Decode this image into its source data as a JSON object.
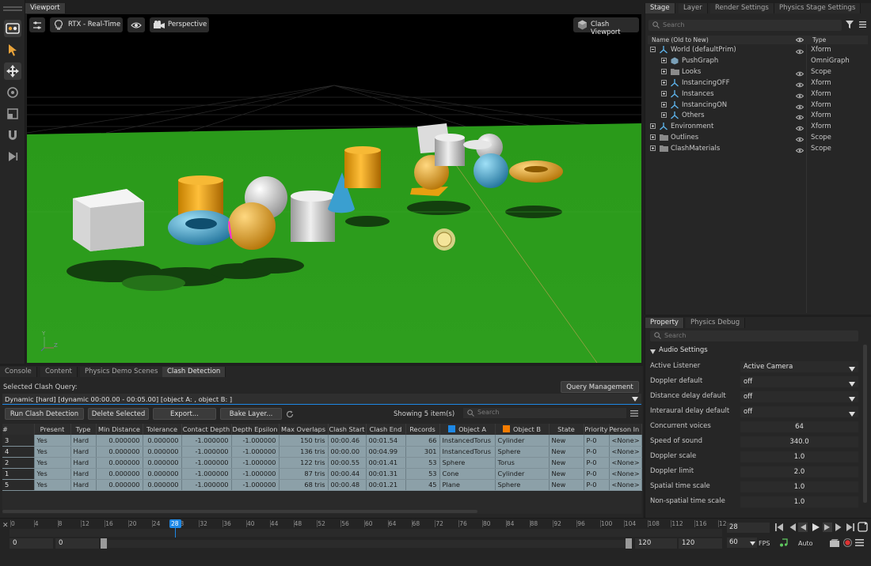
{
  "viewport": {
    "tab": "Viewport",
    "renderer": "RTX - Real-Time",
    "camera": "Perspective",
    "clash_viewport": "Clash Viewport"
  },
  "stage": {
    "tabs": [
      "Stage",
      "Layer",
      "Render Settings",
      "Physics Stage Settings"
    ],
    "search_placeholder": "Search",
    "col_name": "Name (Old to New)",
    "col_type": "Type",
    "tree": [
      {
        "label": "World (defaultPrim)",
        "type": "Xform",
        "indent": 0,
        "icon": "xform",
        "eye": true,
        "expand": "−"
      },
      {
        "label": "PushGraph",
        "type": "OmniGraph",
        "indent": 1,
        "icon": "graph",
        "eye": false,
        "expand": "+"
      },
      {
        "label": "Looks",
        "type": "Scope",
        "indent": 1,
        "icon": "folder",
        "eye": true,
        "expand": "+"
      },
      {
        "label": "InstancingOFF",
        "type": "Xform",
        "indent": 1,
        "icon": "xform",
        "eye": true,
        "expand": "+"
      },
      {
        "label": "Instances",
        "type": "Xform",
        "indent": 1,
        "icon": "xform",
        "eye": true,
        "expand": "+"
      },
      {
        "label": "InstancingON",
        "type": "Xform",
        "indent": 1,
        "icon": "xform",
        "eye": true,
        "expand": "+"
      },
      {
        "label": "Others",
        "type": "Xform",
        "indent": 1,
        "icon": "xform",
        "eye": true,
        "expand": "+"
      },
      {
        "label": "Environment",
        "type": "Xform",
        "indent": 0,
        "icon": "xform",
        "eye": true,
        "expand": "+"
      },
      {
        "label": "Outlines",
        "type": "Scope",
        "indent": 0,
        "icon": "folder",
        "eye": true,
        "expand": "+"
      },
      {
        "label": "ClashMaterials",
        "type": "Scope",
        "indent": 0,
        "icon": "folder",
        "eye": true,
        "expand": "+"
      }
    ]
  },
  "property": {
    "tabs": [
      "Property",
      "Physics Debug"
    ],
    "search_placeholder": "Search",
    "section": "Audio Settings",
    "rows": [
      {
        "label": "Active Listener",
        "value": "Active Camera",
        "kind": "select"
      },
      {
        "label": "Doppler default",
        "value": "off",
        "kind": "select"
      },
      {
        "label": "Distance delay default",
        "value": "off",
        "kind": "select"
      },
      {
        "label": "Interaural delay default",
        "value": "off",
        "kind": "select"
      },
      {
        "label": "Concurrent voices",
        "value": "64",
        "kind": "num"
      },
      {
        "label": "Speed of sound",
        "value": "340.0",
        "kind": "num"
      },
      {
        "label": "Doppler scale",
        "value": "1.0",
        "kind": "num"
      },
      {
        "label": "Doppler limit",
        "value": "2.0",
        "kind": "num"
      },
      {
        "label": "Spatial time scale",
        "value": "1.0",
        "kind": "num"
      },
      {
        "label": "Non-spatial time scale",
        "value": "1.0",
        "kind": "num"
      }
    ]
  },
  "bottom": {
    "tabs": [
      "Console",
      "Content",
      "Physics Demo Scenes",
      "Clash Detection"
    ],
    "selected_query_label": "Selected Clash Query:",
    "query_management": "Query Management",
    "query_value": "Dynamic [hard] [dynamic 00:00.00 - 00:05.00] [object A: , object B: ]",
    "buttons": {
      "run": "Run Clash Detection",
      "delete": "Delete Selected",
      "export": "Export...",
      "bake": "Bake Layer..."
    },
    "showing": "Showing 5 item(s)",
    "search_placeholder": "Search",
    "columns": [
      "#",
      "Present",
      "Type",
      "Min Distance",
      "Tolerance",
      "Contact Depth",
      "Depth Epsilon",
      "Max Overlaps",
      "Clash Start",
      "Clash End",
      "Records",
      "Object A",
      "Object B",
      "State",
      "Priority",
      "Person In C"
    ],
    "rows": [
      [
        "3",
        "Yes",
        "Hard",
        "0.000000",
        "0.000000",
        "-1.000000",
        "-1.000000",
        "150  tris",
        "00:00.46",
        "00:01.54",
        "66",
        "InstancedTorus",
        "Cylinder",
        "New",
        "P-0",
        "<None>"
      ],
      [
        "4",
        "Yes",
        "Hard",
        "0.000000",
        "0.000000",
        "-1.000000",
        "-1.000000",
        "136  tris",
        "00:00.00",
        "00:04.99",
        "301",
        "InstancedTorus",
        "Sphere",
        "New",
        "P-0",
        "<None>"
      ],
      [
        "2",
        "Yes",
        "Hard",
        "0.000000",
        "0.000000",
        "-1.000000",
        "-1.000000",
        "122  tris",
        "00:00.55",
        "00:01.41",
        "53",
        "Sphere",
        "Torus",
        "New",
        "P-0",
        "<None>"
      ],
      [
        "1",
        "Yes",
        "Hard",
        "0.000000",
        "0.000000",
        "-1.000000",
        "-1.000000",
        "87  tris",
        "00:00.44",
        "00:01.31",
        "53",
        "Cone",
        "Cylinder",
        "New",
        "P-0",
        "<None>"
      ],
      [
        "5",
        "Yes",
        "Hard",
        "0.000000",
        "0.000000",
        "-1.000000",
        "-1.000000",
        "68  tris",
        "00:00.48",
        "00:01.21",
        "45",
        "Plane",
        "Sphere",
        "New",
        "P-0",
        "<None>"
      ]
    ]
  },
  "timeline": {
    "ticks": [
      "0",
      "4",
      "8",
      "12",
      "16",
      "20",
      "24",
      "28",
      "32",
      "36",
      "40",
      "44",
      "48",
      "52",
      "56",
      "60",
      "64",
      "68",
      "72",
      "76",
      "80",
      "84",
      "88",
      "92",
      "96",
      "100",
      "104",
      "108",
      "112",
      "116",
      "12"
    ],
    "current_frame": "28",
    "start": "0",
    "start2": "0",
    "end": "120",
    "end2": "120",
    "fps_value": "60",
    "fps_label": "FPS",
    "auto": "Auto"
  },
  "axis": {
    "x": "X",
    "y": "Y",
    "z": "Z"
  },
  "colors": {
    "accent": "#1e88e5",
    "object_a": "#1e88e5",
    "object_b": "#f57c00",
    "row_bg": "#8ca0a8"
  }
}
